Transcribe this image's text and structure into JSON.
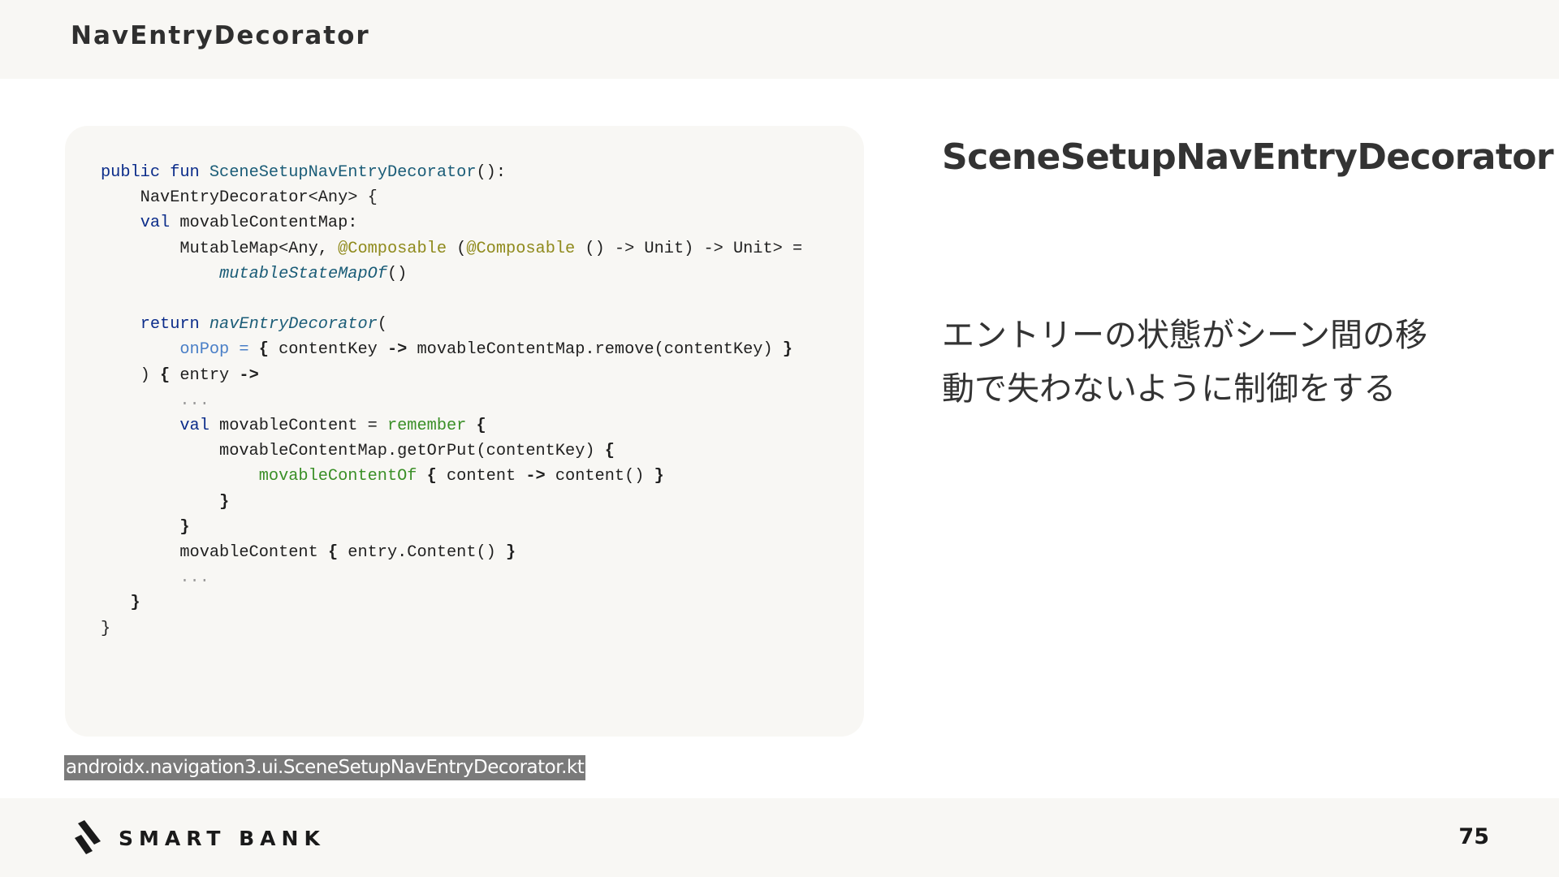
{
  "header": {
    "title": "NavEntryDecorator"
  },
  "code": {
    "lines": [
      [
        {
          "t": "public",
          "c": "kw"
        },
        {
          "t": " "
        },
        {
          "t": "fun",
          "c": "kw"
        },
        {
          "t": " "
        },
        {
          "t": "SceneSetupNavEntryDecorator",
          "c": "fn"
        },
        {
          "t": "():"
        }
      ],
      [
        {
          "t": "    NavEntryDecorator<Any> {"
        }
      ],
      [
        {
          "t": "    "
        },
        {
          "t": "val",
          "c": "kw"
        },
        {
          "t": " movableContentMap:"
        }
      ],
      [
        {
          "t": "        MutableMap<Any, "
        },
        {
          "t": "@Composable",
          "c": "an"
        },
        {
          "t": " ("
        },
        {
          "t": "@Composable",
          "c": "an"
        },
        {
          "t": " () -> Unit) -> Unit> ="
        }
      ],
      [
        {
          "t": "            "
        },
        {
          "t": "mutableStateMapOf",
          "c": "fni"
        },
        {
          "t": "()"
        }
      ],
      [
        {
          "t": ""
        }
      ],
      [
        {
          "t": "    "
        },
        {
          "t": "return",
          "c": "kw"
        },
        {
          "t": " "
        },
        {
          "t": "navEntryDecorator",
          "c": "fni"
        },
        {
          "t": "("
        }
      ],
      [
        {
          "t": "        "
        },
        {
          "t": "onPop =",
          "c": "pa"
        },
        {
          "t": " "
        },
        {
          "t": "{",
          "c": "bd"
        },
        {
          "t": " contentKey "
        },
        {
          "t": "->",
          "c": "bd"
        },
        {
          "t": " movableContentMap.remove(contentKey) "
        },
        {
          "t": "}",
          "c": "bd"
        }
      ],
      [
        {
          "t": "    ) "
        },
        {
          "t": "{",
          "c": "bd"
        },
        {
          "t": " entry "
        },
        {
          "t": "->",
          "c": "bd"
        }
      ],
      [
        {
          "t": "        "
        },
        {
          "t": "...",
          "c": "cm"
        }
      ],
      [
        {
          "t": "        "
        },
        {
          "t": "val",
          "c": "kw"
        },
        {
          "t": " movableContent = "
        },
        {
          "t": "remember",
          "c": "gr"
        },
        {
          "t": " "
        },
        {
          "t": "{",
          "c": "bd"
        }
      ],
      [
        {
          "t": "            movableContentMap.getOrPut(contentKey) "
        },
        {
          "t": "{",
          "c": "bd"
        }
      ],
      [
        {
          "t": "                "
        },
        {
          "t": "movableContentOf",
          "c": "gr"
        },
        {
          "t": " "
        },
        {
          "t": "{",
          "c": "bd"
        },
        {
          "t": " content "
        },
        {
          "t": "->",
          "c": "bd"
        },
        {
          "t": " content() "
        },
        {
          "t": "}",
          "c": "bd"
        }
      ],
      [
        {
          "t": "            "
        },
        {
          "t": "}",
          "c": "bd"
        }
      ],
      [
        {
          "t": "        "
        },
        {
          "t": "}",
          "c": "bd"
        }
      ],
      [
        {
          "t": "        movableContent "
        },
        {
          "t": "{",
          "c": "bd"
        },
        {
          "t": " entry.Content() "
        },
        {
          "t": "}",
          "c": "bd"
        }
      ],
      [
        {
          "t": "        "
        },
        {
          "t": "...",
          "c": "cm"
        }
      ],
      [
        {
          "t": "   "
        },
        {
          "t": "}",
          "c": "bd"
        }
      ],
      [
        {
          "t": "}"
        }
      ]
    ]
  },
  "caption": {
    "text": "androidx.navigation3.ui.SceneSetupNavEntryDecorator.kt"
  },
  "side": {
    "title": "SceneSetupNavEntryDecorator",
    "description_lines": [
      "エントリーの状態がシーン間の移",
      "動で失わないように制御をする"
    ]
  },
  "footer": {
    "logo_text": "SMART BANK",
    "page_number": "75"
  },
  "colors": {
    "panel_bg": "#f8f7f4",
    "keyword": "#0b2c8a",
    "function": "#1a5c77",
    "annotation": "#8f8a1c",
    "builtin": "#3a8f27",
    "parameter": "#4a7fc7",
    "comment": "#9a9a9a",
    "caption_bg": "#7a7a7a"
  }
}
